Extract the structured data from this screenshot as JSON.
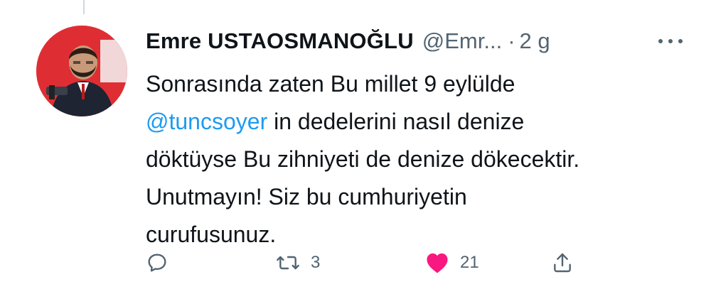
{
  "tweet": {
    "display_name": "Emre USTAOSMANOĞLU",
    "handle": "@Emr...",
    "separator": "·",
    "time": "2 g",
    "text_before_mention": "Sonrasında zaten Bu millet 9 eylülde",
    "mention": "@tuncsoyer",
    "text_after_mention": " in dedelerini nasıl denize",
    "line_3": "döktüyse Bu zihniyeti de denize dökecektir.",
    "line_4": "Unutmayın! Siz bu cumhuriyetin",
    "line_5": "curufusunuz."
  },
  "actions": {
    "reply_icon": "reply-icon",
    "retweet_icon": "retweet-icon",
    "retweet_count": "3",
    "like_icon": "heart-filled-icon",
    "like_count": "21",
    "share_icon": "share-icon"
  },
  "colors": {
    "mention": "#1d9bf0",
    "secondary_text": "#536471",
    "like_active": "#f91880",
    "avatar_background": "#d7262c"
  }
}
